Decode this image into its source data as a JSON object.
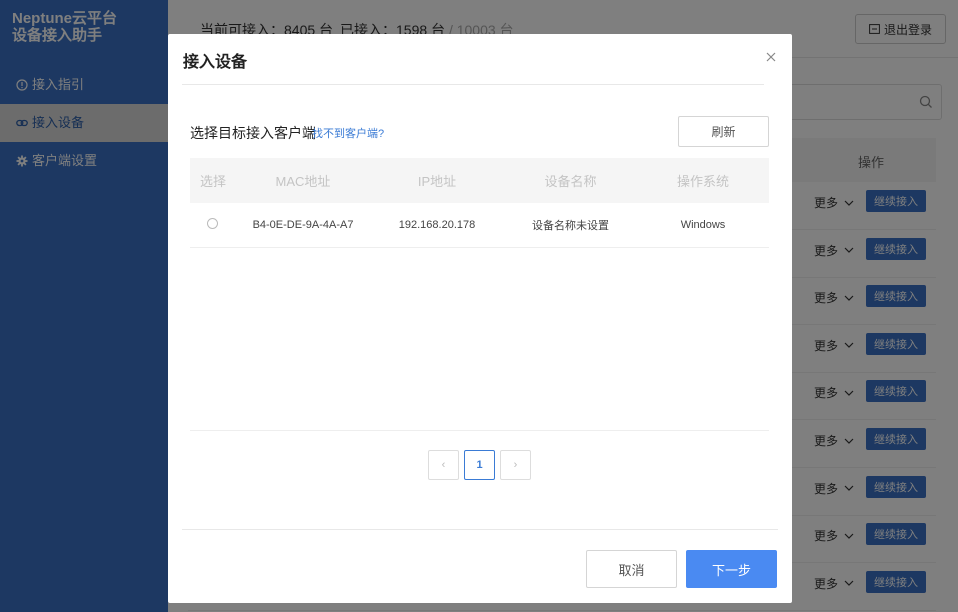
{
  "colors": {
    "sidebar": "#3a71c4",
    "primary": "#4a8af2",
    "link": "#3a7bd5"
  },
  "sidebar": {
    "brand_line1": "Neptune云平台",
    "brand_line2": "设备接入助手",
    "items": [
      {
        "label": "接入指引",
        "icon": "info-icon"
      },
      {
        "label": "接入设备",
        "icon": "link-icon"
      },
      {
        "label": "客户端设置",
        "icon": "gear-icon"
      }
    ]
  },
  "topbar": {
    "available_label": "当前可接入：",
    "available_value": "8405 台",
    "connected_label": "已接入：",
    "connected_value": "1598 台",
    "total_value": "/ 10003 台",
    "logout_label": "退出登录"
  },
  "background": {
    "ops_header": "操作",
    "row_more_label": "更多",
    "row_action_label": "继续接入"
  },
  "modal": {
    "title": "接入设备",
    "section_label": "选择目标接入客户端",
    "help_link": "找不到客户端?",
    "refresh_label": "刷新",
    "columns": [
      "选择",
      "MAC地址",
      "IP地址",
      "设备名称",
      "操作系统"
    ],
    "rows": [
      {
        "mac": "B4-0E-DE-9A-4A-A7",
        "ip": "192.168.20.178",
        "name": "设备名称未设置",
        "os": "Windows"
      }
    ],
    "pagination": {
      "prev": "‹",
      "current": "1",
      "next": "›"
    },
    "cancel_label": "取消",
    "next_label": "下一步"
  }
}
